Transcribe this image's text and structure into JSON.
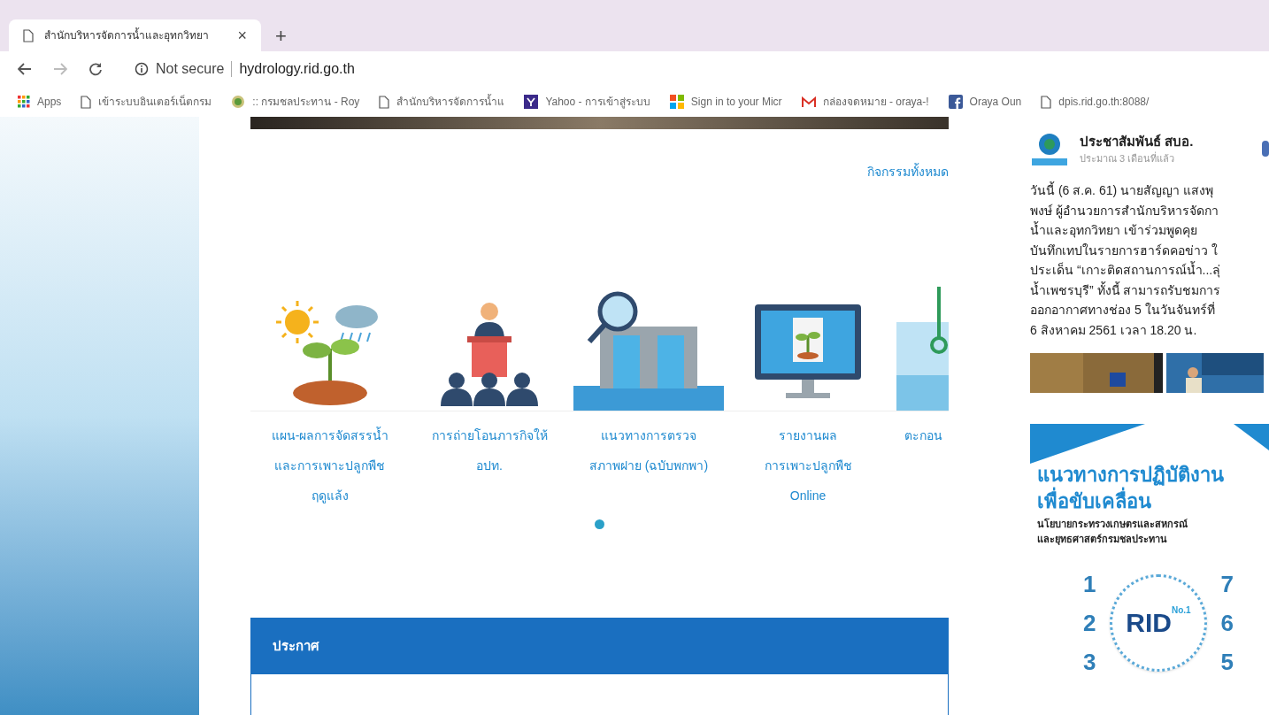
{
  "tab": {
    "title": "สำนักบริหารจัดการน้ำและอุทกวิทยา",
    "close": "×",
    "new_tab": "+"
  },
  "address_bar": {
    "security": "Not secure",
    "url": "hydrology.rid.go.th"
  },
  "bookmarks": [
    {
      "kind": "apps",
      "label": "Apps"
    },
    {
      "kind": "page",
      "label": "เข้าระบบอินเตอร์เน็ตกรม"
    },
    {
      "kind": "emblem",
      "label": ":: กรมชลประทาน - Roy"
    },
    {
      "kind": "page",
      "label": "สำนักบริหารจัดการน้ำแ"
    },
    {
      "kind": "yahoo",
      "label": "Yahoo - การเข้าสู่ระบบ"
    },
    {
      "kind": "microsoft",
      "label": "Sign in to your Micr"
    },
    {
      "kind": "mail",
      "label": "กล่องจดหมาย - oraya-!"
    },
    {
      "kind": "facebook",
      "label": "Oraya Oun"
    },
    {
      "kind": "page",
      "label": "dpis.rid.go.th:8088/"
    }
  ],
  "activities": {
    "all_link": "กิจกรรมทั้งหมด",
    "items": [
      {
        "kind": "plant",
        "lines": [
          "แผน-ผลการจัดสรรน้ำ",
          "และการเพาะปลูกพืช",
          "ฤดูแล้ง"
        ]
      },
      {
        "kind": "speaker",
        "lines": [
          "การถ่ายโอนภารกิจให้",
          "อปท."
        ]
      },
      {
        "kind": "dam",
        "lines": [
          "แนวทางการตรวจ",
          "สภาพฝาย (ฉบับพกพา)"
        ]
      },
      {
        "kind": "monitor",
        "lines": [
          "รายงานผล",
          "การเพาะปลูกพืช",
          "Online"
        ]
      },
      {
        "kind": "gauge",
        "lines": [
          "ตะกอน"
        ]
      }
    ],
    "dots": [
      {
        "selected": true
      }
    ]
  },
  "announcements": {
    "title": "ประกาศ"
  },
  "facebook_post": {
    "page_name": "ประชาสัมพันธ์ สบอ.",
    "time": "ประมาณ 3 เดือนที่แล้ว",
    "lines": [
      "วันนี้ (6 ส.ค. 61) นายสัญญา แสงพุ",
      "พงษ์ ผู้อำนวยการสำนักบริหารจัดกา",
      "น้ำและอุทกวิทยา เข้าร่วมพูดคุย",
      "บันทึกเทปในรายการฮาร์ดคอข่าว ใ",
      "ประเด็น “เกาะติดสถานการณ์น้ำ...ลุ่",
      "น้ำเพชรบุรี” ทั้งนี้ สามารถรับชมการ",
      "ออกอากาศทางช่อง 5 ในวันจันทร์ที่",
      "6 สิงหาคม 2561 เวลา 18.20 น."
    ]
  },
  "banner": {
    "title_lines": [
      "แนวทางการปฏิบัติงาน",
      "เพื่อขับเคลื่อน"
    ],
    "subtitle_lines": [
      "นโยบายกระทรวงเกษตรและสหกรณ์",
      "และยุทธศาสตร์กรมชลประทาน"
    ],
    "left_numbers": [
      "1",
      "2",
      "3"
    ],
    "right_numbers": [
      "7",
      "6",
      "5"
    ],
    "logo": "RID",
    "logo_badge": "No.1"
  }
}
